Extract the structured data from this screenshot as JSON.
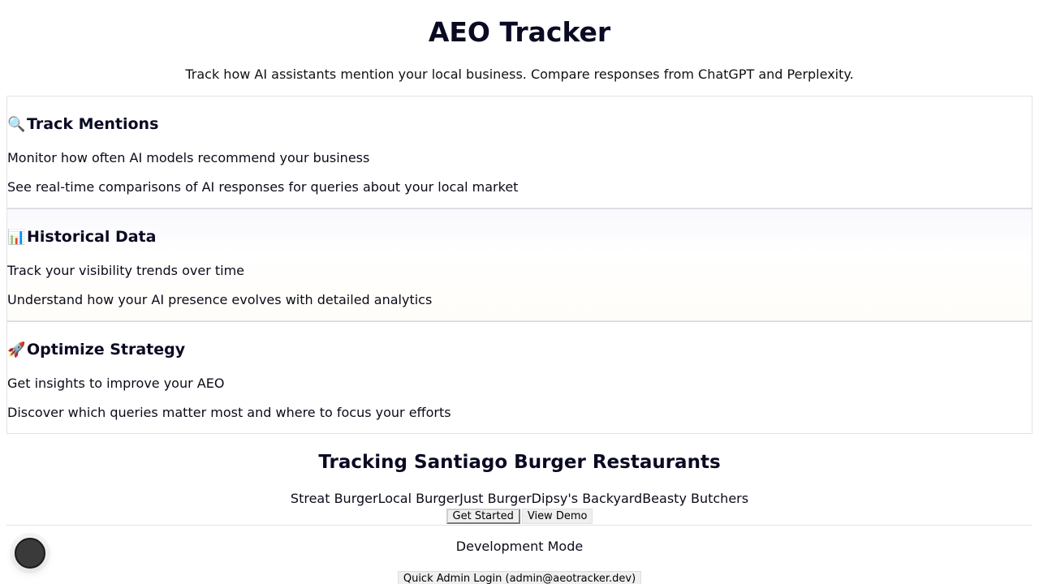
{
  "header": {
    "title": "AEO Tracker",
    "subtitle": "Track how AI assistants mention your local business. Compare responses from ChatGPT and Perplexity."
  },
  "features": [
    {
      "icon": "magnifier-icon",
      "emoji": "🔍",
      "title": "Track Mentions",
      "line1": "Monitor how often AI models recommend your business",
      "line2": "See real-time comparisons of AI responses for queries about your local market"
    },
    {
      "icon": "bar-chart-icon",
      "emoji": "📊",
      "title": "Historical Data",
      "line1": "Track your visibility trends over time",
      "line2": "Understand how your AI presence evolves with detailed analytics"
    },
    {
      "icon": "rocket-icon",
      "emoji": "🚀",
      "title": "Optimize Strategy",
      "line1": "Get insights to improve your AEO",
      "line2": "Discover which queries matter most and where to focus your efforts"
    }
  ],
  "tracking": {
    "title": "Tracking Santiago Burger Restaurants",
    "restaurants": [
      "Streat Burger",
      "Local Burger",
      "Just Burger",
      "Dipsy's Backyard",
      "Beasty Butchers"
    ]
  },
  "actions": {
    "get_started": "Get Started",
    "view_demo": "View Demo"
  },
  "dev": {
    "mode_label": "Development Mode",
    "admin_login": "Quick Admin Login (admin@aeotracker.dev)"
  },
  "colors": {
    "heading": "#0a0a23",
    "fab": "#3a3a3a"
  }
}
